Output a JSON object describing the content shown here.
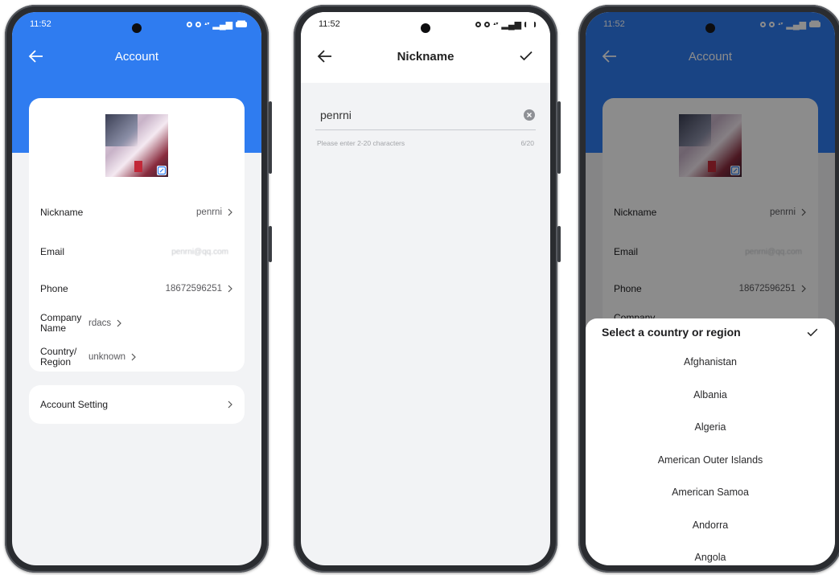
{
  "status": {
    "time": "11:52"
  },
  "colors": {
    "accent": "#2f7cf0",
    "background": "#f2f3f5",
    "card": "#ffffff"
  },
  "account": {
    "title": "Account",
    "rows": [
      {
        "label": "Nickname",
        "value": "penrni"
      },
      {
        "label": "Email",
        "value": "penrni@qq.com"
      },
      {
        "label": "Phone",
        "value": "18672596251"
      },
      {
        "label": "Company Name",
        "value": "rdacs"
      },
      {
        "label": "Country/ Region",
        "value": "unknown"
      }
    ],
    "setting_label": "Account Setting"
  },
  "nickname": {
    "title": "Nickname",
    "input_value": "penrni",
    "hint": "Please enter 2-20 characters",
    "counter": "6/20"
  },
  "country_sheet": {
    "title": "Select a country or region",
    "items": [
      "Afghanistan",
      "Albania",
      "Algeria",
      "American Outer Islands",
      "American Samoa",
      "Andorra",
      "Angola"
    ]
  }
}
